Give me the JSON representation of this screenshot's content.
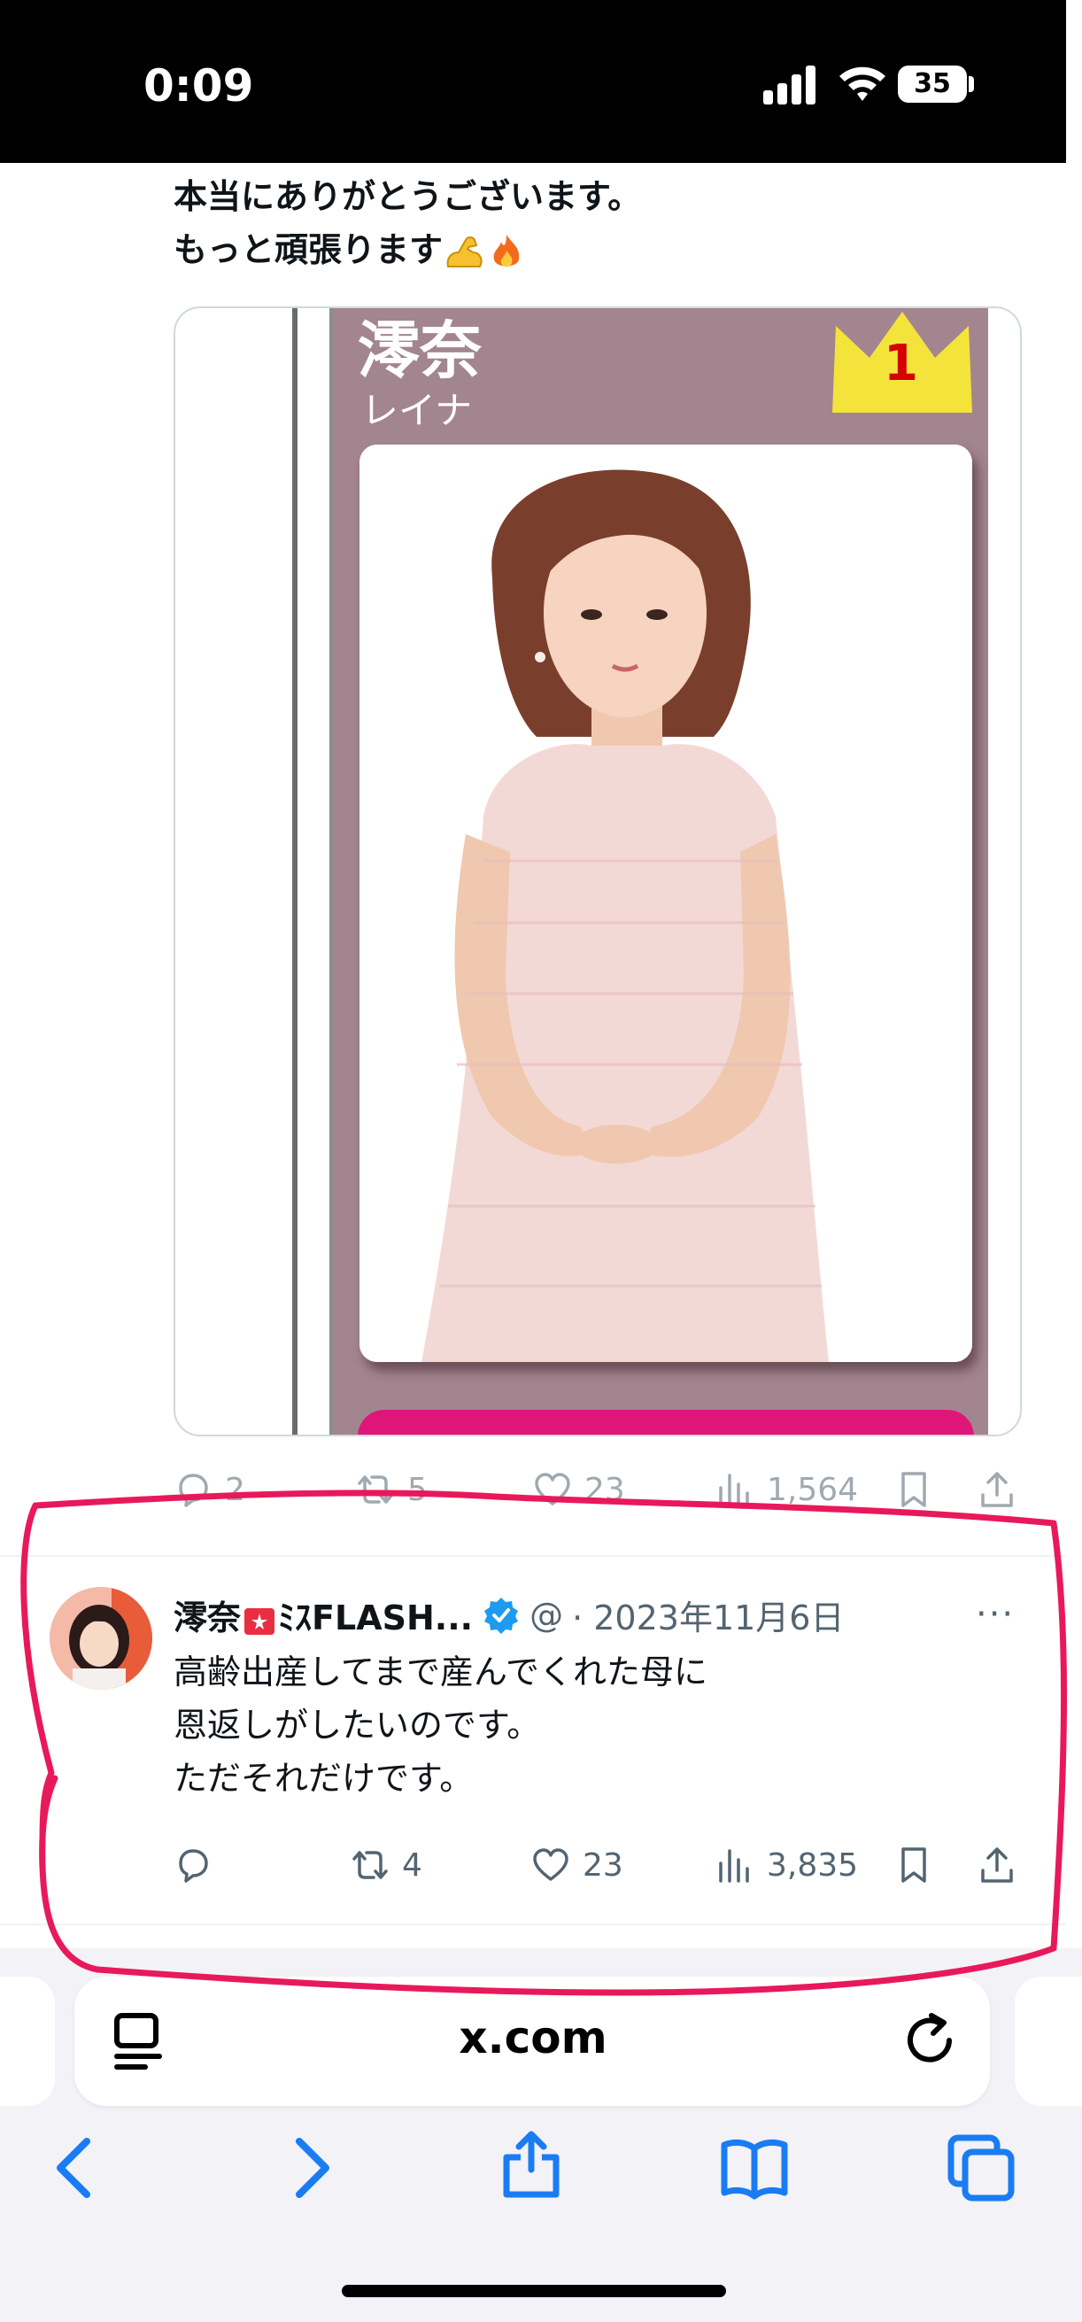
{
  "status_bar": {
    "time": "0:09",
    "battery": "35"
  },
  "tweet1": {
    "line1": "本当にありがとうございます。",
    "line2": "もっと頑張ります",
    "card": {
      "name": "澪奈",
      "kana": "レイナ",
      "rank": "1"
    },
    "actions": {
      "replies": "2",
      "retweets": "5",
      "likes": "23",
      "views": "1,564"
    }
  },
  "tweet2": {
    "name": "澪奈",
    "name_suffix": "ﾐｽFLASH...",
    "handle": "@",
    "date": "· 2023年11月6日",
    "more": "···",
    "lines": [
      "高齢出産してまで産んでくれた母に",
      "恩返しがしたいのです。",
      "ただそれだけです。"
    ],
    "actions": {
      "replies": "",
      "retweets": "4",
      "likes": "23",
      "views": "3,835"
    }
  },
  "browser": {
    "url": "x.com"
  },
  "icons": [
    "signal-icon",
    "wifi-icon",
    "battery-icon",
    "reply-icon",
    "retweet-icon",
    "like-icon",
    "views-icon",
    "bookmark-icon",
    "share-icon",
    "verified-icon",
    "reader-icon",
    "reload-icon",
    "back-icon",
    "forward-icon",
    "share-sheet-icon",
    "bookmarks-icon",
    "tabs-icon"
  ],
  "colors": {
    "accent": "#1d9bf0",
    "annotation": "#e8195a",
    "card_purple": "#a3858f",
    "card_button": "#e0157a",
    "crown": "#f4e33b"
  }
}
